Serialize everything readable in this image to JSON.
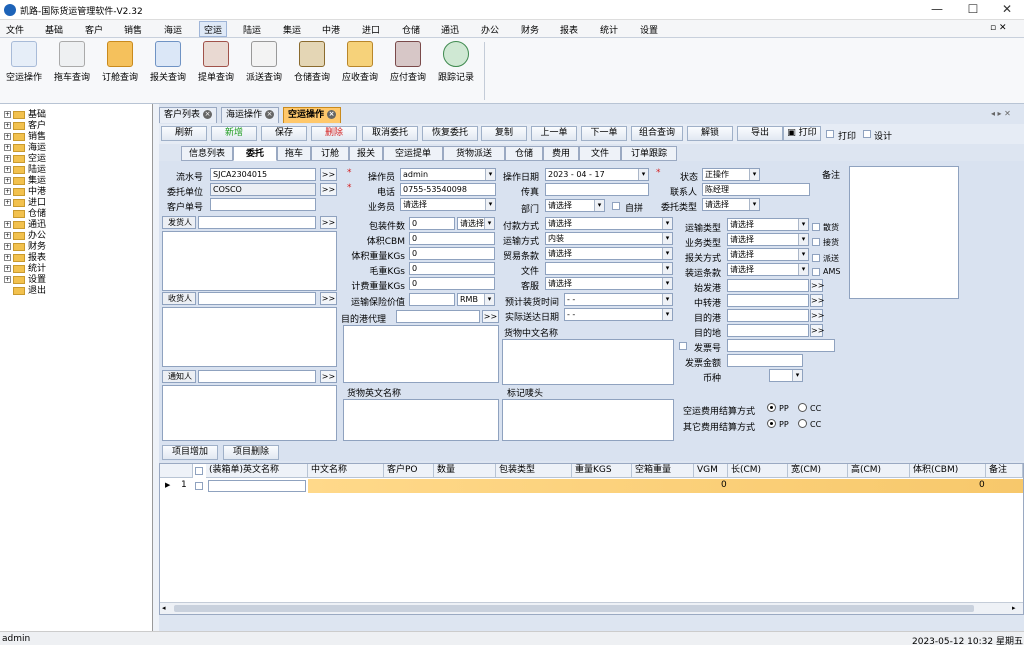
{
  "window": {
    "title": "凯路-国际货运管理软件-V2.32",
    "minimize": "—",
    "maximize": "☐",
    "close": "✕"
  },
  "menu": [
    "文件",
    "基础",
    "客户",
    "销售",
    "海运",
    "空运",
    "陆运",
    "集运",
    "中港",
    "进口",
    "仓储",
    "通迅",
    "办公",
    "财务",
    "报表",
    "统计",
    "设置"
  ],
  "menu_active": "空运",
  "ribbon": [
    "空运操作",
    "拖车查询",
    "订舱查询",
    "报关查询",
    "提单查询",
    "派送查询",
    "仓储查询",
    "应收查询",
    "应付查询",
    "跟踪记录"
  ],
  "tree": [
    "基础",
    "客户",
    "销售",
    "海运",
    "空运",
    "陆运",
    "集运",
    "中港",
    "进口",
    "仓储",
    "通迅",
    "办公",
    "财务",
    "报表",
    "统计",
    "设置",
    "退出"
  ],
  "doc_tabs": [
    "客户列表",
    "海运操作",
    "空运操作"
  ],
  "doc_tab_active": "空运操作",
  "toolbar": [
    "刷新",
    "新增",
    "保存",
    "删除",
    "取消委托",
    "恢复委托",
    "复制",
    "上一单",
    "下一单",
    "组合查询",
    "解锁",
    "导出",
    "打印"
  ],
  "toolbar_checks": {
    "print": "打印",
    "design": "设计"
  },
  "sub_tabs": [
    "信息列表",
    "委托",
    "拖车",
    "订舱",
    "报关",
    "空运提单",
    "货物派送",
    "仓储",
    "费用",
    "文件",
    "订单跟踪"
  ],
  "sub_tab_active": "委托",
  "form": {
    "serial_label": "流水号",
    "serial": "SJCA2304015",
    "client_label": "委托单位",
    "client": "COSCO",
    "client_no_label": "客户单号",
    "client_no": "",
    "shipper_label": "发货人",
    "consignee_label": "收货人",
    "notify_label": "通知人",
    "operator_label": "操作员",
    "operator": "admin",
    "phone_label": "电话",
    "phone": "0755-53540098",
    "sales_label": "业务员",
    "sales": "请选择",
    "pkg_count_label": "包装件数",
    "pkg_count": "0",
    "pkg_select": "请选择",
    "volume_label": "体积CBM",
    "volume": "0",
    "vol_weight_label": "体积重量KGs",
    "vol_weight": "0",
    "gross_weight_label": "毛重KGs",
    "gross_weight": "0",
    "charge_weight_label": "计费重量KGs",
    "charge_weight": "0",
    "insurance_label": "运输保险价值",
    "insurance_currency": "RMB",
    "dest_agent_label": "目的港代理",
    "cargo_en_label": "货物英文名称",
    "op_date_label": "操作日期",
    "op_date": "2023 - 04 - 17",
    "fax_label": "传真",
    "fax": "",
    "dept_label": "部门",
    "dept": "请选择",
    "self_pickup": "自拼",
    "payment_label": "付款方式",
    "payment": "请选择",
    "transport_label": "运输方式",
    "transport": "内装",
    "trade_terms_label": "贸易条款",
    "trade_terms": "请选择",
    "docs_label": "文件",
    "docs": "",
    "cs_label": "客服",
    "cs": "请选择",
    "load_time_label": "预计装货时间",
    "load_time": "-   -",
    "delivery_date_label": "实际送达日期",
    "delivery_date": "-   -",
    "cargo_cn_label": "货物中文名称",
    "marks_label": "标记唛头",
    "status_label": "状态",
    "status": "正操作",
    "contact_label": "联系人",
    "contact": "陈经理",
    "entrust_type_label": "委托类型",
    "entrust_type": "请选择",
    "ship_type_label": "运输类型",
    "ship_type": "请选择",
    "biz_type_label": "业务类型",
    "biz_type": "请选择",
    "customs_label": "报关方式",
    "customs": "请选择",
    "load_terms_label": "装运条款",
    "load_terms": "请选择",
    "origin_port_label": "始发港",
    "transit_port_label": "中转港",
    "dest_port_label": "目的港",
    "dest_label": "目的地",
    "invoice_no_label": "发票号",
    "invoice_amt_label": "发票金额",
    "currency_label": "币种",
    "remarks_label": "备注",
    "opt_bulk": "散货",
    "opt_pickup": "接货",
    "opt_deliver": "派送",
    "opt_ams": "AMS",
    "air_fee_label": "空运费用结算方式",
    "other_fee_label": "其它费用结算方式",
    "pp": "PP",
    "cc": "CC",
    "add_item": "项目增加",
    "del_item": "项目删除"
  },
  "grid": {
    "columns": [
      "(装箱单)英文名称",
      "中文名称",
      "客户PO",
      "数量",
      "包装类型",
      "重量KGS",
      "空箱重量",
      "VGM",
      "长(CM)",
      "宽(CM)",
      "高(CM)",
      "体积(CBM)",
      "备注"
    ],
    "row_no": "1",
    "vgm_value": "0",
    "volume_value": "0"
  },
  "status": {
    "user": "admin",
    "datetime": "2023-05-12 10:32 星期五"
  },
  "colors": {
    "active_tab": "#ffc86b",
    "form_bg": "#d9e2f0",
    "required": "#d41e1e"
  }
}
